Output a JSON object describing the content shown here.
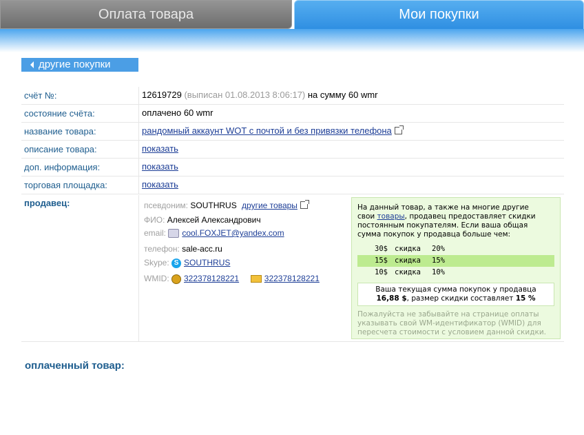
{
  "tabs": {
    "pay": "Оплата товара",
    "my": "Мои покупки"
  },
  "back_button": "другие покупки",
  "rows": [
    {
      "label": "счёт №:",
      "value": "12619729",
      "extra": "(выписан 01.08.2013 8:06:17)",
      "tail": "на сумму 60 wmr"
    },
    {
      "label": "состояние счёта:",
      "value": "оплачено 60 wmr"
    },
    {
      "label": "название товара:",
      "link": "рандомный аккаунт WOT с почтой и без привязки телефона"
    },
    {
      "label": "описание товара:",
      "link": "показать"
    },
    {
      "label": "доп. информация:",
      "link": "показать"
    },
    {
      "label": "торговая площадка:",
      "link": "показать"
    }
  ],
  "seller": {
    "title": "продавец:",
    "nick_label": "псевдоним:",
    "nick": "SOUTHRUS",
    "other_goods": "другие товары",
    "fio_label": "ФИО:",
    "fio": "Алексей Александрович",
    "email_label": "email:",
    "email": "cool.FOXJET@yandex.com",
    "phone_label": "телефон:",
    "phone": "sale-acc.ru",
    "skype_label": "Skype:",
    "skype": "SOUTHRUS",
    "wmid_label": "WMID:",
    "wmid": "322378128221",
    "wmid2": "322378128221"
  },
  "discount": {
    "intro_1": "На данный товар, а также на многие другие",
    "intro_2a": "свои ",
    "intro_link": "товары",
    "intro_2b": ", продавец предоставляет скидки",
    "intro_3": "постоянным покупателям. Если ваша общая",
    "intro_4": "сумма покупок у продавца больше чем:",
    "tiers": [
      {
        "amount": "30$",
        "word": "скидка",
        "pct": "20%"
      },
      {
        "amount": "15$",
        "word": "скидка",
        "pct": "15%",
        "active": true
      },
      {
        "amount": "10$",
        "word": "скидка",
        "pct": "10%"
      }
    ],
    "current_1": "Ваша текущая сумма покупок у продавца",
    "current_sum": "16,88 $",
    "current_mid": ", размер скидки составляет ",
    "current_pct": "15 %",
    "note": "Пожалуйста не забывайте на странице оплаты указывать свой WM-идентификатор (WMID) для пересчета стоимости с условием данной скидки.",
    "active_color": "#bdeb90"
  },
  "paid_title": "оплаченный товар:"
}
